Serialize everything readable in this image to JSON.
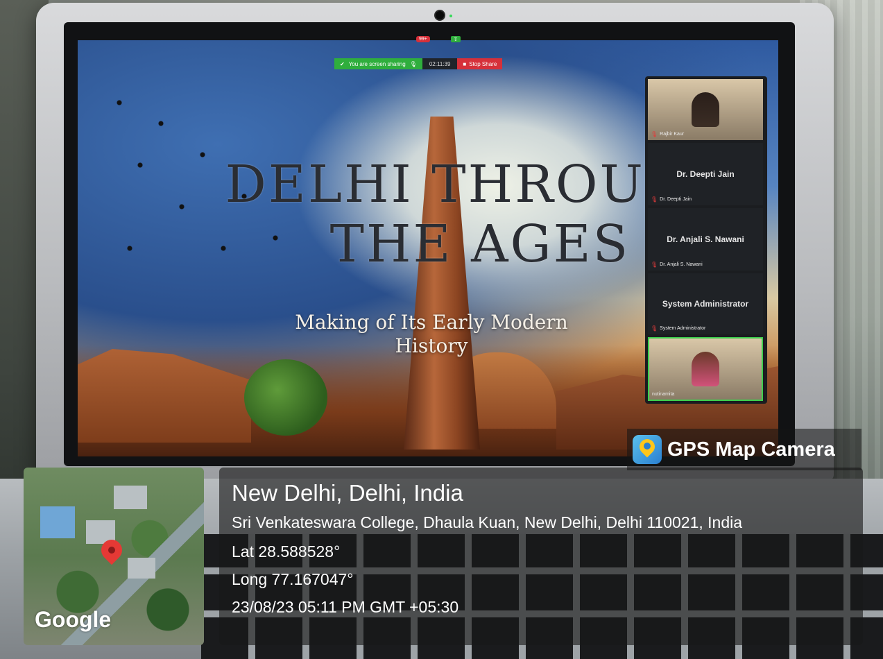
{
  "zoom": {
    "badge_count": "99+",
    "share_status": "You are screen sharing",
    "timer": "02:11:39",
    "stop_share": "Stop Share"
  },
  "slide": {
    "title_line1": "DELHI THROUGH",
    "title_line2": "THE AGES",
    "subtitle": "Making of Its Early Modern History"
  },
  "participants": [
    {
      "display": "",
      "caption": "Rajbir Kaur",
      "video": true
    },
    {
      "display": "Dr. Deepti Jain",
      "caption": "Dr. Deepti Jain",
      "video": false
    },
    {
      "display": "Dr. Anjali S. Nawani",
      "caption": "Dr. Anjali S. Nawani",
      "video": false
    },
    {
      "display": "System Administrator",
      "caption": "System Administrator",
      "video": false
    },
    {
      "display": "",
      "caption": "nutinamita",
      "video": true
    }
  ],
  "gps": {
    "brand": "GPS Map Camera",
    "place": "New Delhi, Delhi, India",
    "address": "Sri Venkateswara College, Dhaula Kuan, New Delhi, Delhi 110021, India",
    "lat": "Lat 28.588528°",
    "long": "Long 77.167047°",
    "timestamp": "23/08/23 05:11 PM GMT +05:30",
    "map_label": "Google"
  }
}
